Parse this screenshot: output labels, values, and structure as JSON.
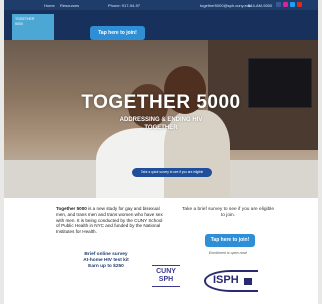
{
  "topbar": {
    "home": "Home",
    "resources": "Resources",
    "phone": "Phone: 917-94-97",
    "email": "together5000@sph.cuny.edu",
    "phone2": "844-AM-5000"
  },
  "header": {
    "logo_line1": "TOGETHER",
    "logo_line2": "5000",
    "join_label": "Tap here to join!"
  },
  "hero": {
    "title": "TOGETHER 5000",
    "subtitle_line1": "ADDRESSING & ENDING HIV",
    "subtitle_line2": "TOGETHER",
    "pill_label": "Take a quick survey to see if you are eligible"
  },
  "description": {
    "lead": "Together 5000",
    "body": " is a new study for gay and bisexual men, and trans men and trans women who have sex with men. It is being conducted by the CUNY School of Public Health in NYC and funded by the National Institutes for Health."
  },
  "promo": {
    "line1": "Brief online survey",
    "line2": "At-home HIV test kit",
    "line3": "Earn up to $250"
  },
  "survey": {
    "text": "Take a brief survey to see if you are eligible to join.",
    "join_label": "Tap here to join!",
    "enroll_note": "Enrollment is open now!"
  },
  "logos": {
    "cuny_line1": "CUNY",
    "cuny_line2": "SPH",
    "isph": "ISPH"
  },
  "colors": {
    "navy": "#18315c",
    "accent_blue": "#2f8fd6"
  }
}
